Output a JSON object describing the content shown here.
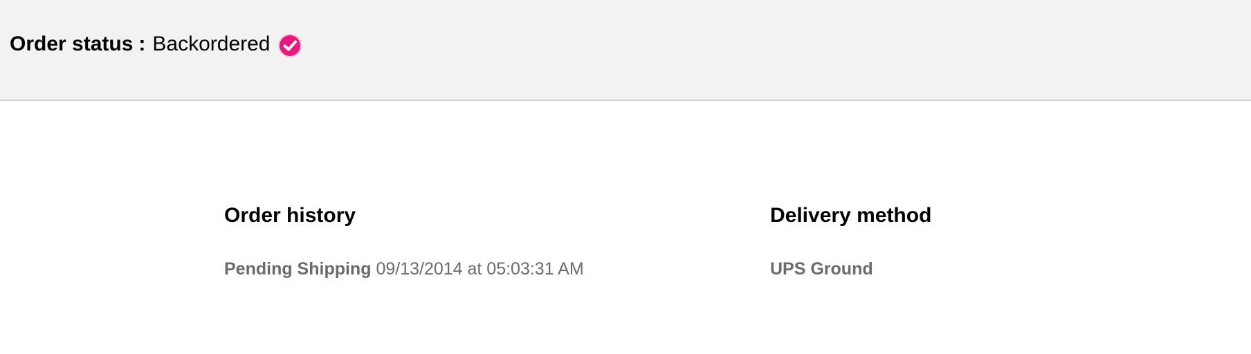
{
  "status": {
    "label": "Order status",
    "separator": ":",
    "value": "Backordered",
    "icon": "check-circle-icon",
    "icon_color": "#e6197f"
  },
  "order_history": {
    "title": "Order history",
    "entries": [
      {
        "status": "Pending Shipping",
        "timestamp": "09/13/2014 at 05:03:31 AM"
      }
    ]
  },
  "delivery": {
    "title": "Delivery method",
    "method": "UPS Ground"
  },
  "colors": {
    "header_bg": "#f2f2f2",
    "divider": "#cfcfcf",
    "muted_text": "#6b6b6b",
    "accent": "#e6197f"
  }
}
